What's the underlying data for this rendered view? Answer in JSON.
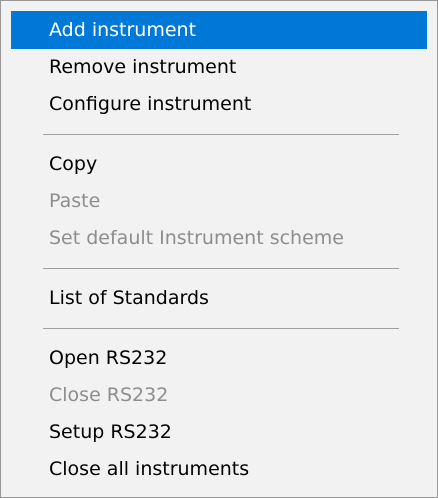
{
  "context_menu": {
    "items": [
      {
        "label": "Add instrument",
        "state": "highlighted"
      },
      {
        "label": "Remove instrument",
        "state": "enabled"
      },
      {
        "label": "Configure instrument",
        "state": "enabled"
      },
      {
        "separator": true
      },
      {
        "label": "Copy",
        "state": "enabled"
      },
      {
        "label": "Paste",
        "state": "disabled"
      },
      {
        "label": "Set default Instrument scheme",
        "state": "disabled"
      },
      {
        "separator": true
      },
      {
        "label": "List of Standards",
        "state": "enabled"
      },
      {
        "separator": true
      },
      {
        "label": "Open RS232",
        "state": "enabled"
      },
      {
        "label": "Close RS232",
        "state": "disabled"
      },
      {
        "label": "Setup RS232",
        "state": "enabled"
      },
      {
        "label": "Close all instruments",
        "state": "enabled"
      }
    ],
    "colors": {
      "highlight_background": "#0078d7",
      "highlight_text": "#ffffff",
      "disabled_text": "#8d8d8d",
      "menu_background": "#f2f2f2"
    }
  }
}
